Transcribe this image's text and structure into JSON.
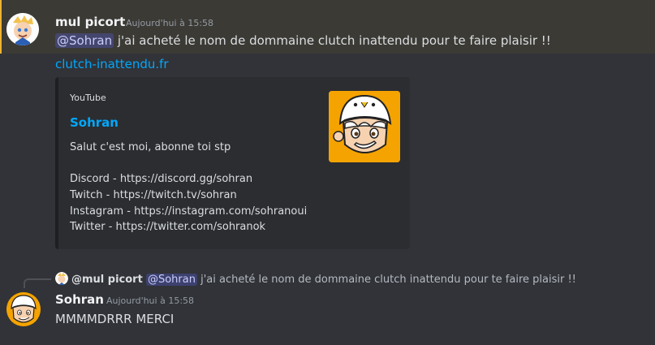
{
  "message1": {
    "author": "mul picort",
    "timestamp": "Aujourd'hui à 15:58",
    "mention": "@Sohran",
    "text": " j'ai acheté le nom de dommaine clutch inattendu pour te faire plaisir !!",
    "link": "clutch-inattendu.fr",
    "embed": {
      "provider": "YouTube",
      "title": "Sohran",
      "description_lines": [
        "Salut c'est moi, abonne toi stp",
        "",
        "Discord - https://discord.gg/sohran",
        "Twitch - https://twitch.tv/sohran",
        "Instagram - https://instagram.com/sohranoui",
        "Twitter - https://twitter.com/sohranok"
      ],
      "thumbnail_bg": "#f5a300"
    }
  },
  "message2": {
    "reply": {
      "author": "@mul picort",
      "mention": "@Sohran",
      "text": " j'ai acheté le nom de dommaine clutch inattendu pour te faire plaisir !!"
    },
    "author": "Sohran",
    "timestamp": "Aujourd'hui à 15:58",
    "text": "MMMMDRRR MERCI"
  },
  "colors": {
    "background": "#313338",
    "highlight": "#3c3a35",
    "link": "#00a8fc",
    "mention_bg": "rgba(88,101,242,0.3)"
  }
}
